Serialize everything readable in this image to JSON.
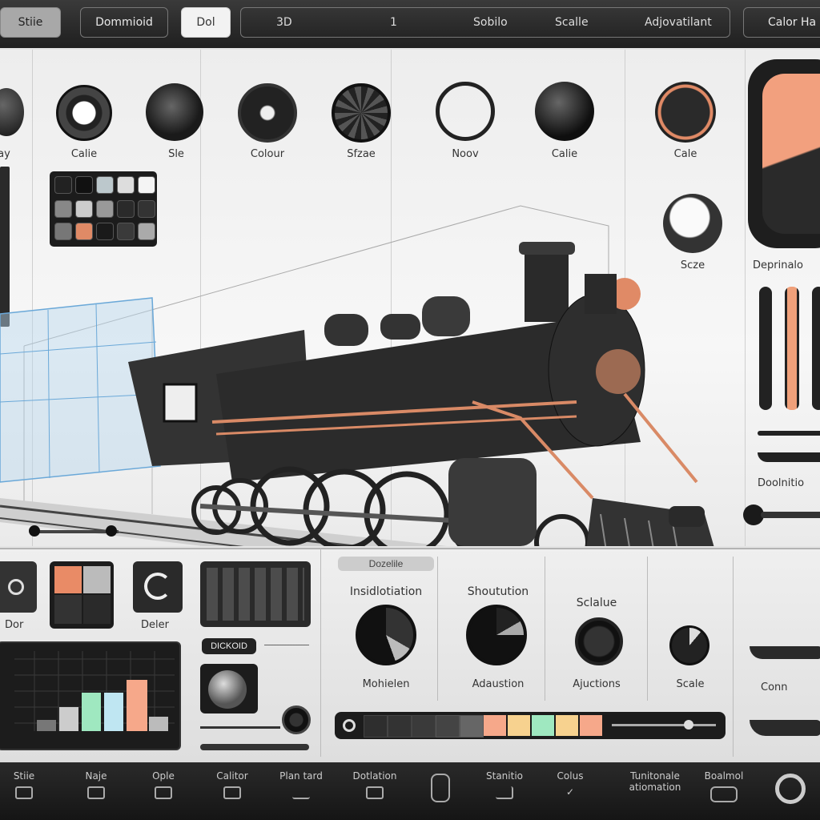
{
  "topbar": {
    "btn1": "Stiie",
    "btn2": "Dommioid",
    "btn3": "Dol",
    "seg": [
      "3D",
      "1",
      "Sobilo",
      "Scalle",
      "Adjovatilant"
    ],
    "btn4": "Calor Ha"
  },
  "knobs": {
    "labels": [
      "ay",
      "Calie",
      "Sle",
      "Colour",
      "Sfzae",
      "Noov",
      "Calie",
      "Cale",
      "Scze",
      "Deprinalo"
    ]
  },
  "right": {
    "label1": "Doolnitio"
  },
  "panel": {
    "left_label_1": "Dor",
    "left_label_2": "Deler",
    "chip_label": "DICKOID",
    "section_tag": "Dozelile",
    "col1_top": "Insidlotiation",
    "col1_bottom": "Mohielen",
    "col2_top": "Shoutution",
    "col2_bottom": "Adaustion",
    "col3_top": "Sclalue",
    "col3_bottom": "Ajuctions",
    "col4_bottom": "Scale",
    "right_label": "Conn"
  },
  "bottombar": {
    "items": [
      "Stiie",
      "Naje",
      "Ople",
      "Calitor",
      "Plan tard",
      "Dotlation",
      "",
      "Stanitio",
      "Colus",
      "Tunitonale",
      "Boalmol",
      ""
    ],
    "item9_sub": "atiomation"
  },
  "colors": {
    "accent": "#f0a07a",
    "mint": "#9fe8c0",
    "yellow": "#f7d28f",
    "dark": "#1c1c1c"
  }
}
